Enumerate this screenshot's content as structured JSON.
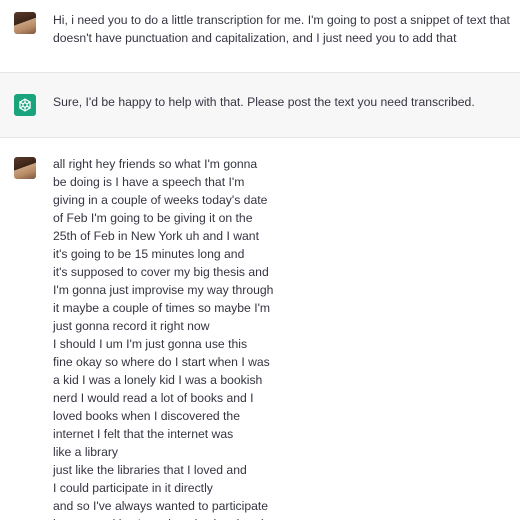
{
  "messages": [
    {
      "role": "user",
      "avatar_icon": "user-photo-avatar",
      "text": "Hi, i need you to do a little transcription for me. I'm going to post a snippet of text that doesn't have punctuation and capitalization, and I just need you to add that"
    },
    {
      "role": "assistant",
      "avatar_icon": "openai-logo-icon",
      "text": "Sure, I'd be happy to help with that. Please post the text you need transcribed."
    },
    {
      "role": "user",
      "avatar_icon": "user-photo-avatar",
      "lines": [
        "all right hey friends so what I'm gonna",
        "be doing is I have a speech that I'm",
        "giving in a couple of weeks today's date",
        "of Feb I'm going to be giving it on the",
        "25th of Feb in New York uh and I want",
        "it's going to be 15 minutes long and",
        "it's supposed to cover my big thesis and",
        "I'm gonna just improvise my way through",
        "it maybe a couple of times so maybe I'm",
        "just gonna record it right now",
        "I should I um I'm just gonna use this",
        "fine okay so where do I start when I was",
        "a kid I was a lonely kid I was a bookish",
        "nerd I would read a lot of books and I",
        "loved books when I discovered the",
        "internet I felt that the internet was",
        "like a library",
        "just like the libraries that I loved and",
        "I could participate in it directly",
        "and so I've always wanted to participate",
        "in communities I used to play in a band"
      ]
    }
  ],
  "colors": {
    "assistant_bg": "#f7f7f8",
    "text": "#343541",
    "bot_avatar": "#19a47e"
  }
}
